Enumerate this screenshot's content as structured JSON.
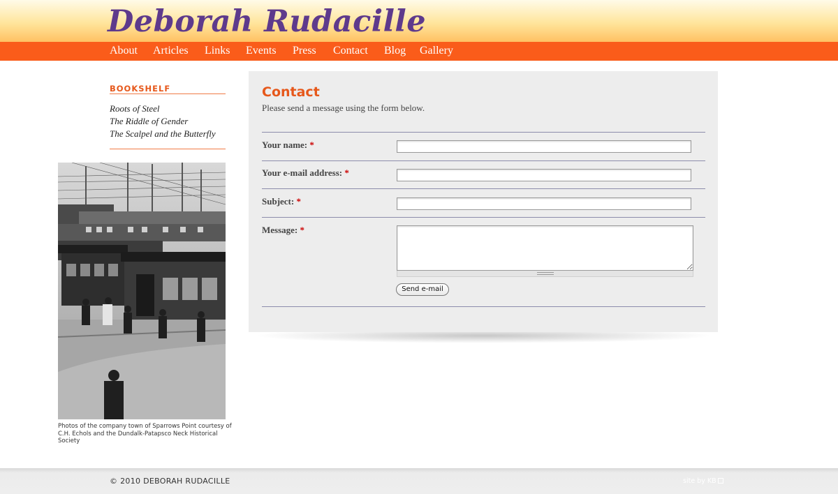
{
  "site": {
    "title": "Deborah Rudacille"
  },
  "nav": {
    "items": [
      {
        "label": "About"
      },
      {
        "label": "Articles"
      },
      {
        "label": "Links"
      },
      {
        "label": "Events"
      },
      {
        "label": "Press"
      },
      {
        "label": "Contact"
      },
      {
        "label": "Blog"
      },
      {
        "label": "Gallery"
      }
    ]
  },
  "sidebar": {
    "heading": "BOOKSHELF",
    "books": [
      {
        "title": "Roots of Steel"
      },
      {
        "title": "The Riddle of Gender"
      },
      {
        "title": "The Scalpel and the Butterfly"
      }
    ],
    "photo_caption": "Photos of the company town of Sparrows Point courtesy of C.H. Echols and the Dundalk-Patapsco Neck Historical Society"
  },
  "contact": {
    "title": "Contact",
    "intro": "Please send a message using the form below.",
    "required_marker": "*",
    "fields": [
      {
        "label": "Your name:",
        "value": ""
      },
      {
        "label": "Your e-mail address:",
        "value": ""
      },
      {
        "label": "Subject:",
        "value": ""
      },
      {
        "label": "Message:",
        "value": ""
      }
    ],
    "submit_label": "Send e-mail"
  },
  "footer": {
    "copyright": "© 2010 DEBORAH RUDACILLE",
    "credit": "site by KB"
  },
  "colors": {
    "accent_orange": "#fa5c1a",
    "title_purple": "#5e3a8c",
    "panel_bg": "#ededed"
  }
}
